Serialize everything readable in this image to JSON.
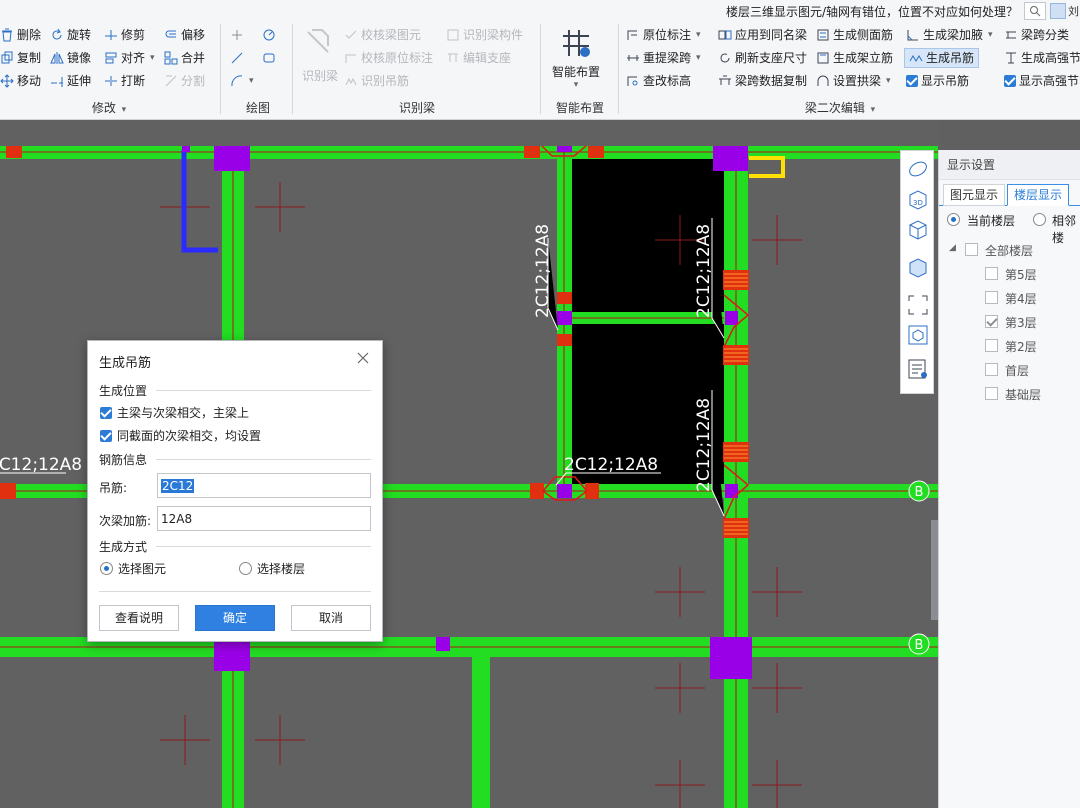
{
  "search": {
    "text": "楼层三维显示图元/轴网有错位，位置不对应如何处理？",
    "user": "刘"
  },
  "ribbon": {
    "modify": {
      "title": "修改",
      "items": [
        "删除",
        "旋转",
        "修剪",
        "偏移",
        "复制",
        "镜像",
        "对齐",
        "合并",
        "移动",
        "延伸",
        "打断",
        "分割"
      ]
    },
    "draw": {
      "title": "绘图"
    },
    "identify": {
      "title": "识别梁",
      "big": "识别梁",
      "items": [
        "校核梁图元",
        "识别梁构件",
        "校核原位标注",
        "编辑支座",
        "识别吊筋"
      ]
    },
    "smart": {
      "title": "智能布置",
      "big": "智能布置"
    },
    "secondary": {
      "title": "梁二次编辑",
      "items": [
        "原位标注",
        "应用到同名梁",
        "生成侧面筋",
        "生成梁加腋",
        "梁跨分类",
        "重提梁跨",
        "刷新支座尺寸",
        "生成架立筋",
        "生成吊筋",
        "生成高强节",
        "查改标高",
        "梁跨数据复制",
        "设置拱梁",
        "显示吊筋",
        "显示高强节"
      ]
    }
  },
  "canvas": {
    "labels": [
      "2C12;12A8",
      "2C12;12A8",
      "2C12;12A8",
      "2C12;12A8",
      "2C12;12A8"
    ],
    "axis_markers": [
      "B",
      "B"
    ]
  },
  "panel": {
    "title": "显示设置",
    "tabs": [
      "图元显示",
      "楼层显示"
    ],
    "radios": [
      "当前楼层",
      "相邻楼"
    ],
    "tree_root": "全部楼层",
    "floors": [
      "第5层",
      "第4层",
      "第3层",
      "第2层",
      "首层",
      "基础层"
    ],
    "checked_floor": "第3层"
  },
  "dialog": {
    "title": "生成吊筋",
    "section_position": "生成位置",
    "check1": "主梁与次梁相交，主梁上",
    "check2": "同截面的次梁相交，均设置",
    "section_rebar": "钢筋信息",
    "hanger_label": "吊筋:",
    "hanger_value": "2C12",
    "extra_label": "次梁加筋:",
    "extra_value": "12A8",
    "section_mode": "生成方式",
    "mode_options": [
      "选择图元",
      "选择楼层"
    ],
    "mode_selected": "选择图元",
    "buttons": {
      "help": "查看说明",
      "ok": "确定",
      "cancel": "取消"
    }
  }
}
